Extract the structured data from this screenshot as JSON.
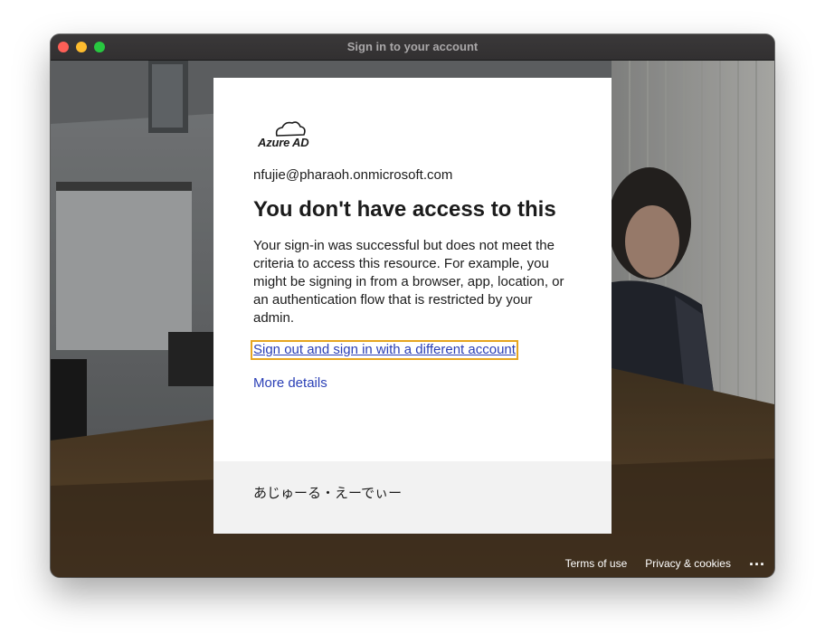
{
  "window": {
    "title": "Sign in to your account"
  },
  "card": {
    "logo_text": "Azure AD",
    "email": "nfujie@pharaoh.onmicrosoft.com",
    "heading": "You don't have access to this",
    "description": "Your sign-in was successful but does not meet the criteria to access this resource. For example, you might be signing in from a browser, app, location, or an authentication flow that is restricted by your admin.",
    "signout_link": "Sign out and sign in with a different account",
    "more_details_link": "More details",
    "organization_name": "あじゅーる・えーでぃー"
  },
  "footer": {
    "terms": "Terms of use",
    "privacy": "Privacy & cookies",
    "more": "..."
  },
  "colors": {
    "link": "#2a3fb6",
    "focus_outline": "#e6a520",
    "footer_band": "#f2f2f2"
  }
}
